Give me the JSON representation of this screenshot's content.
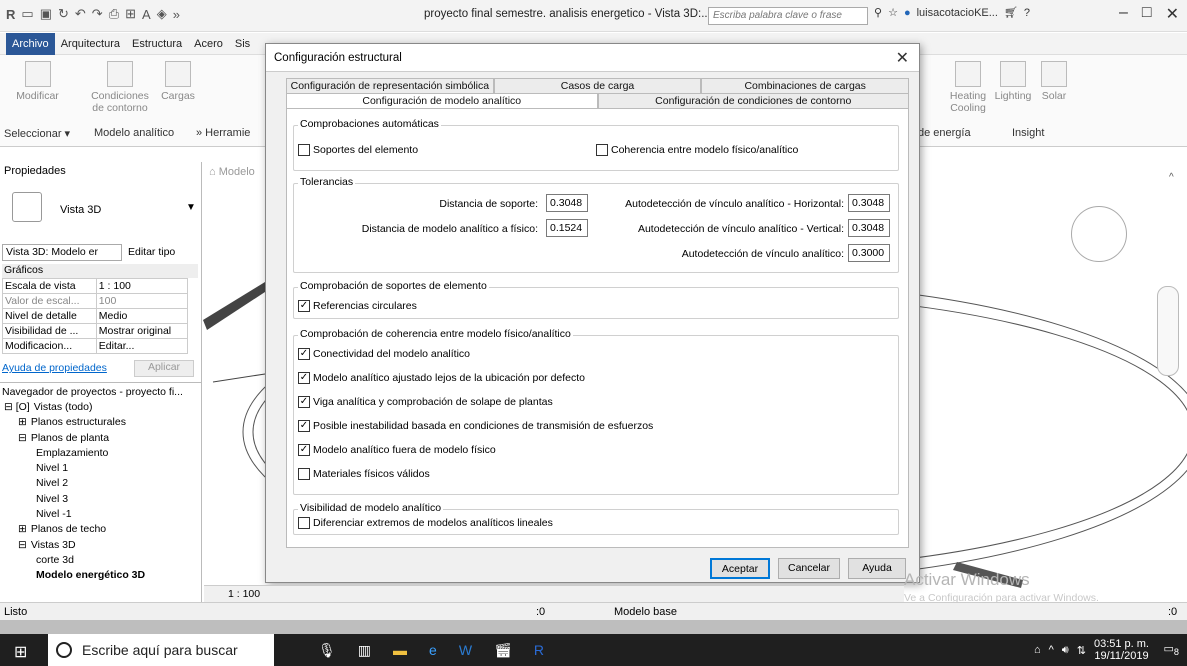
{
  "app": {
    "window_title": "proyecto final semestre. analisis energetico - Vista 3D:...",
    "search_placeholder": "Escriba palabra clave o frase",
    "user_name": "luisacotacioKE..."
  },
  "menu": [
    "Archivo",
    "Arquitectura",
    "Estructura",
    "Acero",
    "Sis"
  ],
  "ribbon": {
    "buttons": [
      {
        "label": "Modificar"
      },
      {
        "label": "Condiciones de contorno"
      },
      {
        "label": "Cargas"
      }
    ],
    "right_buttons": [
      {
        "label": "Heating Cooling"
      },
      {
        "label": "Lighting"
      },
      {
        "label": "Solar"
      }
    ],
    "panels": [
      "Seleccionar ▾",
      "Modelo analítico",
      "» Herramie"
    ],
    "right_panels": [
      "de energía",
      "Insight"
    ]
  },
  "properties": {
    "title": "Propiedades",
    "type_name": "Vista 3D",
    "view_selector": "Vista 3D: Modelo er",
    "edit_type": "Editar tipo",
    "section": "Gráficos",
    "rows": [
      {
        "k": "Escala de vista",
        "v": "1 : 100"
      },
      {
        "k": "Valor de escal...",
        "v": "100"
      },
      {
        "k": "Nivel de detalle",
        "v": "Medio"
      },
      {
        "k": "Visibilidad de ...",
        "v": "Mostrar original"
      },
      {
        "k": "Modificacion...",
        "v": "Editar..."
      }
    ],
    "help_link": "Ayuda de propiedades",
    "apply": "Aplicar"
  },
  "browser": {
    "title": "Navegador de proyectos - proyecto fi...",
    "items": [
      {
        "label": "Vistas (todo)",
        "indent": 0,
        "prefix": "⊟ [O]"
      },
      {
        "label": "Planos estructurales",
        "indent": 1,
        "prefix": "⊞"
      },
      {
        "label": "Planos de planta",
        "indent": 1,
        "prefix": "⊟"
      },
      {
        "label": "Emplazamiento",
        "indent": 2,
        "prefix": ""
      },
      {
        "label": "Nivel 1",
        "indent": 2,
        "prefix": ""
      },
      {
        "label": "Nivel 2",
        "indent": 2,
        "prefix": ""
      },
      {
        "label": "Nivel 3",
        "indent": 2,
        "prefix": ""
      },
      {
        "label": "Nivel -1",
        "indent": 2,
        "prefix": ""
      },
      {
        "label": "Planos de techo",
        "indent": 1,
        "prefix": "⊞"
      },
      {
        "label": "Vistas 3D",
        "indent": 1,
        "prefix": "⊟"
      },
      {
        "label": "corte 3d",
        "indent": 2,
        "prefix": ""
      },
      {
        "label": "Modelo energético 3D",
        "indent": 2,
        "prefix": "",
        "bold": true
      }
    ]
  },
  "view": {
    "tab_label": "Modelo",
    "scale": "1 : 100"
  },
  "dialog": {
    "title": "Configuración estructural",
    "tabs_back": [
      "Configuración de representación simbólica",
      "Casos de carga",
      "Combinaciones de cargas"
    ],
    "tabs_front": [
      "Configuración de modelo analítico",
      "Configuración de condiciones de contorno"
    ],
    "auto_checks": {
      "label": "Comprobaciones automáticas",
      "items": [
        {
          "label": "Soportes del elemento",
          "checked": false
        },
        {
          "label": "Coherencia entre modelo físico/analítico",
          "checked": false
        }
      ]
    },
    "tolerances": {
      "label": "Tolerancias",
      "left": [
        {
          "label": "Distancia de soporte:",
          "value": "0.3048"
        },
        {
          "label": "Distancia de modelo analítico a físico:",
          "value": "0.1524"
        }
      ],
      "right": [
        {
          "label": "Autodetección de vínculo analítico - Horizontal:",
          "value": "0.3048"
        },
        {
          "label": "Autodetección de vínculo analítico - Vertical:",
          "value": "0.3048"
        },
        {
          "label": "Autodetección de vínculo analítico:",
          "value": "0.3000"
        }
      ]
    },
    "support_check": {
      "label": "Comprobación de soportes de elemento",
      "items": [
        {
          "label": "Referencias circulares",
          "checked": true
        }
      ]
    },
    "consistency": {
      "label": "Comprobación de coherencia entre modelo físico/analítico",
      "items": [
        {
          "label": "Conectividad del modelo analítico",
          "checked": true
        },
        {
          "label": "Modelo analítico ajustado lejos de la ubicación por defecto",
          "checked": true
        },
        {
          "label": "Viga analítica y comprobación de solape de plantas",
          "checked": true
        },
        {
          "label": "Posible inestabilidad basada en condiciones de transmisión de esfuerzos",
          "checked": true
        },
        {
          "label": "Modelo analítico fuera de modelo físico",
          "checked": true
        },
        {
          "label": "Materiales físicos válidos",
          "checked": false
        }
      ]
    },
    "visibility": {
      "label": "Visibilidad de modelo analítico",
      "items": [
        {
          "label": "Diferenciar extremos de modelos analíticos lineales",
          "checked": false
        }
      ]
    },
    "buttons": {
      "ok": "Aceptar",
      "cancel": "Cancelar",
      "help": "Ayuda"
    }
  },
  "status": {
    "text": "Listo",
    "zero1": ":0",
    "model": "Modelo base",
    "zero2": ":0"
  },
  "watermark": {
    "line1": "Activar Windows",
    "line2": "Ve a Configuración para activar Windows."
  },
  "taskbar": {
    "search": "Escribe aquí para buscar",
    "time": "03:51 p. m.",
    "date": "19/11/2019",
    "notif": "8"
  }
}
